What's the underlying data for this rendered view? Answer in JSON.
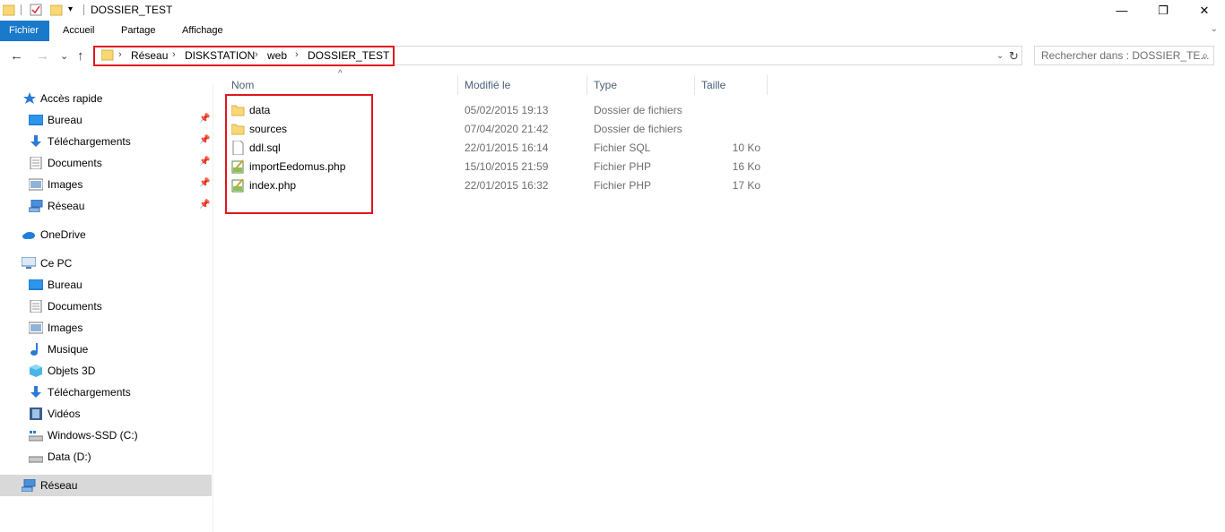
{
  "window": {
    "title": "DOSSIER_TEST",
    "minimize_glyph": "—",
    "maximize_glyph": "❐",
    "close_glyph": "✕"
  },
  "ribbon": {
    "tabs": [
      {
        "label": "Fichier",
        "active": true
      },
      {
        "label": "Accueil",
        "active": false
      },
      {
        "label": "Partage",
        "active": false
      },
      {
        "label": "Affichage",
        "active": false
      }
    ],
    "expand_glyph": "⌄"
  },
  "nav": {
    "back_glyph": "←",
    "forward_glyph": "→",
    "recent_glyph": "⌄",
    "up_glyph": "↑",
    "breadcrumb": [
      "Réseau",
      "DISKSTATION",
      "web",
      "DOSSIER_TEST"
    ],
    "dropdown_glyph": "⌄",
    "refresh_glyph": "↻"
  },
  "search": {
    "placeholder": "Rechercher dans : DOSSIER_TE...",
    "icon": "search-icon"
  },
  "sidebar": {
    "items": [
      {
        "label": "Accès rapide",
        "icon": "star-icon",
        "pinned": false
      },
      {
        "label": "Bureau",
        "icon": "desktop-icon",
        "pinned": true
      },
      {
        "label": "Téléchargements",
        "icon": "download-icon",
        "pinned": true
      },
      {
        "label": "Documents",
        "icon": "documents-icon",
        "pinned": true
      },
      {
        "label": "Images",
        "icon": "images-icon",
        "pinned": true
      },
      {
        "label": "Réseau",
        "icon": "network-icon",
        "pinned": true
      },
      {
        "label": "OneDrive",
        "icon": "cloud-icon",
        "pinned": false
      },
      {
        "label": "Ce PC",
        "icon": "computer-icon",
        "pinned": false
      },
      {
        "label": "Bureau",
        "icon": "desktop-icon",
        "pinned": false
      },
      {
        "label": "Documents",
        "icon": "documents-icon",
        "pinned": false
      },
      {
        "label": "Images",
        "icon": "images-icon",
        "pinned": false
      },
      {
        "label": "Musique",
        "icon": "music-icon",
        "pinned": false
      },
      {
        "label": "Objets 3D",
        "icon": "cube-icon",
        "pinned": false
      },
      {
        "label": "Téléchargements",
        "icon": "download-icon",
        "pinned": false
      },
      {
        "label": "Vidéos",
        "icon": "video-icon",
        "pinned": false
      },
      {
        "label": "Windows-SSD (C:)",
        "icon": "drive-c-icon",
        "pinned": false
      },
      {
        "label": "Data (D:)",
        "icon": "drive-icon",
        "pinned": false
      },
      {
        "label": "Réseau",
        "icon": "network-icon",
        "pinned": false,
        "selected": true
      }
    ],
    "pin_glyph": "📌"
  },
  "columns": {
    "name": "Nom",
    "modified": "Modifié le",
    "type": "Type",
    "size": "Taille",
    "sort_glyph": "^"
  },
  "files": [
    {
      "name": "data",
      "modified": "05/02/2015 19:13",
      "type": "Dossier de fichiers",
      "size": "",
      "icon": "folder-icon"
    },
    {
      "name": "sources",
      "modified": "07/04/2020 21:42",
      "type": "Dossier de fichiers",
      "size": "",
      "icon": "folder-icon"
    },
    {
      "name": "ddl.sql",
      "modified": "22/01/2015 16:14",
      "type": "Fichier SQL",
      "size": "10 Ko",
      "icon": "file-icon"
    },
    {
      "name": "importEedomus.php",
      "modified": "15/10/2015 21:59",
      "type": "Fichier PHP",
      "size": "16 Ko",
      "icon": "php-file-icon"
    },
    {
      "name": "index.php",
      "modified": "22/01/2015 16:32",
      "type": "Fichier PHP",
      "size": "17 Ko",
      "icon": "php-file-icon"
    }
  ],
  "colors": {
    "accent": "#1979ca",
    "highlight_box": "#e0161d",
    "folder": "#f8d775",
    "selected_bg": "#d9d9d9"
  }
}
